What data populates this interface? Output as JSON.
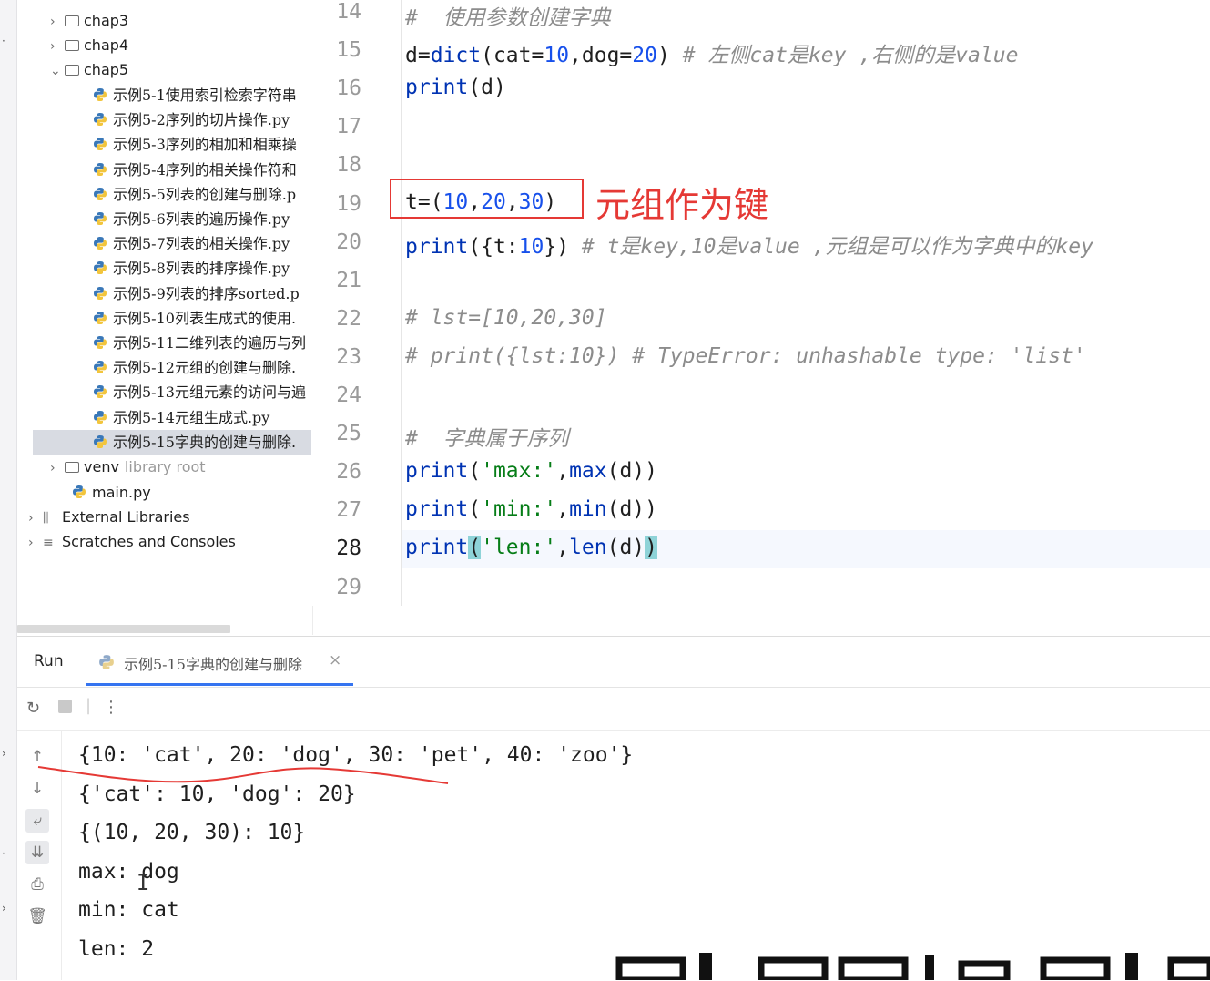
{
  "project_tree": {
    "folders": [
      {
        "label": "chap3",
        "expanded": false
      },
      {
        "label": "chap4",
        "expanded": false
      },
      {
        "label": "chap5",
        "expanded": true
      }
    ],
    "files": [
      "示例5-1使用索引检索字符串",
      "示例5-2序列的切片操作.py",
      "示例5-3序列的相加和相乘操",
      "示例5-4序列的相关操作符和",
      "示例5-5列表的创建与删除.p",
      "示例5-6列表的遍历操作.py",
      "示例5-7列表的相关操作.py",
      "示例5-8列表的排序操作.py",
      "示例5-9列表的排序sorted.p",
      "示例5-10列表生成式的使用.",
      "示例5-11二维列表的遍历与列",
      "示例5-12元组的创建与删除.",
      "示例5-13元组元素的访问与遍",
      "示例5-14元组生成式.py",
      "示例5-15字典的创建与删除."
    ],
    "selected_file_index": 14,
    "venv": {
      "label": "venv",
      "hint": "library root"
    },
    "main_file": "main.py",
    "external_libraries": "External Libraries",
    "scratches": "Scratches and Consoles"
  },
  "editor": {
    "line_numbers": [
      "14",
      "15",
      "16",
      "17",
      "18",
      "19",
      "20",
      "21",
      "22",
      "23",
      "24",
      "25",
      "26",
      "27",
      "28",
      "29"
    ],
    "current_line": "28",
    "annotation": "元组作为键"
  },
  "run_panel": {
    "label": "Run",
    "tab_label": "示例5-15字典的创建与删除",
    "output_lines": [
      "{10: 'cat', 20: 'dog', 30: 'pet', 40: 'zoo'}",
      "{'cat': 10, 'dog': 20}",
      "{(10, 20, 30): 10}",
      "max: dog",
      "min: cat",
      "len: 2"
    ]
  },
  "colors": {
    "annotation_red": "#e53935",
    "number_blue": "#1750eb",
    "string_green": "#067d17",
    "comment_gray": "#8c8c8c",
    "bracket_highlight": "#8ed3d8",
    "tab_underline": "#3574f0"
  },
  "icons": [
    "chevron-right-icon",
    "chevron-down-icon",
    "folder-icon",
    "python-file-icon",
    "library-icon",
    "scratches-icon",
    "rerun-icon",
    "stop-icon",
    "more-icon",
    "up-arrow-icon",
    "down-arrow-icon",
    "soft-wrap-icon",
    "scroll-to-end-icon",
    "print-icon",
    "trash-icon",
    "close-icon"
  ]
}
